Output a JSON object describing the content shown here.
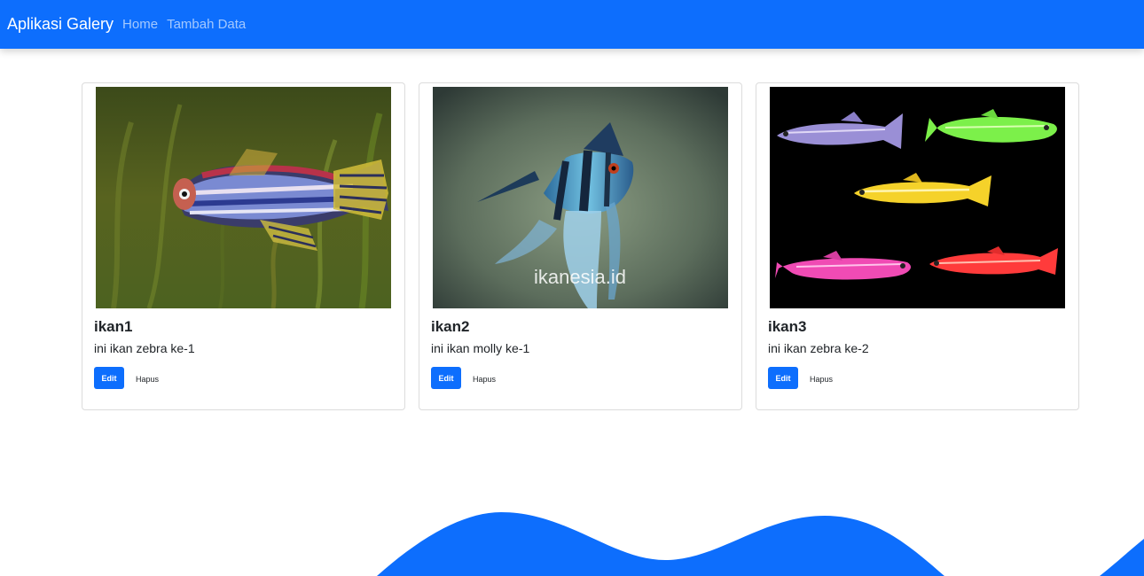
{
  "navbar": {
    "brand": "Aplikasi Galery",
    "links": [
      "Home",
      "Tambah Data"
    ]
  },
  "cards": [
    {
      "title": "ikan1",
      "text": "ini ikan zebra ke-1",
      "edit_label": "Edit",
      "delete_label": "Hapus",
      "image": "zebra-fish-photo"
    },
    {
      "title": "ikan2",
      "text": "ini ikan molly ke-1",
      "edit_label": "Edit",
      "delete_label": "Hapus",
      "image": "angel-fish-photo",
      "watermark": "ikanesia.id"
    },
    {
      "title": "ikan3",
      "text": "ini ikan zebra ke-2",
      "edit_label": "Edit",
      "delete_label": "Hapus",
      "image": "glofish-photo"
    }
  ],
  "colors": {
    "primary": "#0d6efd",
    "wave": "#0d6efd"
  }
}
